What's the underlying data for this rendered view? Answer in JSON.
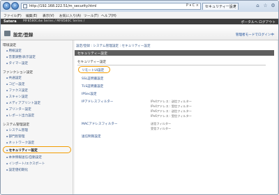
{
  "browser": {
    "url": "http://192.168.222.51/m_security.html",
    "url_tools": "P ▾ C ×",
    "tab_label": "セキュリティー設定",
    "tab_close": "×",
    "menu": [
      "ファイル(F)",
      "編集(E)",
      "表示(V)",
      "お気に入り(A)",
      "ツール(T)",
      "ヘルプ(H)"
    ]
  },
  "product": {
    "brand": "Satera",
    "model": "MF8580Cdw Series / MF8580C Series /",
    "top_right": "ポータルへ  ログアウト"
  },
  "page": {
    "title": "設定/登録",
    "title_right": "管理者モードでログイン中"
  },
  "sidebar": {
    "sections": [
      {
        "label": "環境設定",
        "items": [
          "用紙設定",
          "音量調整/表示設定",
          "タイマー設定"
        ]
      },
      {
        "label": "ファンクション設定",
        "items": [
          "共通設定",
          "コピー設定",
          "ファクス設定",
          "スキャン設定",
          "メディアプリント設定",
          "プリンター設定",
          "レポート出力設定"
        ]
      },
      {
        "label": "システム管理設定",
        "items": [
          "システム管理",
          "部門別管理",
          "ネットワーク設定",
          "セキュリティー設定",
          "本体情報送信/自動設定",
          "インポート/エクスポート",
          "設定値初期化"
        ]
      }
    ],
    "active_item": "セキュリティー設定"
  },
  "content": {
    "breadcrumb": "設定/登録 : システム管理設定 : セキュリティー設定",
    "header": "セキュリティー設定",
    "subheader": "セキュリティー設定",
    "items": [
      {
        "label": "リモートUI設定",
        "desc": []
      },
      {
        "label": "SSL証明書設定",
        "desc": []
      },
      {
        "label": "TLS証明書設定",
        "desc": []
      },
      {
        "label": "IPSec設定",
        "desc": []
      },
      {
        "label": "IPアドレスフィルター",
        "desc": [
          "IPv4アドレス : 送信フィルター",
          "IPv4アドレス : 受信フィルター",
          "IPv6アドレス : 送信フィルター",
          "IPv6アドレス : 受信フィルター"
        ]
      },
      {
        "label": "MACアドレスフィルター",
        "desc": [
          "送信フィルター",
          "受信フィルター"
        ]
      },
      {
        "label": "送信制限設定",
        "desc": []
      }
    ]
  },
  "colors": {
    "highlight": "#f29c00",
    "header_dark": "#3c3c3c",
    "link": "#2b4f8a"
  }
}
